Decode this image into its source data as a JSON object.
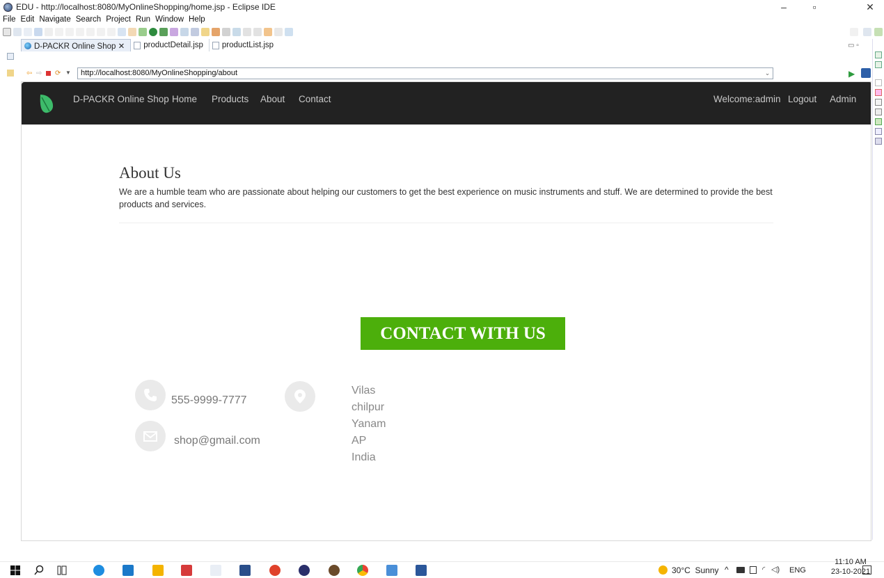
{
  "window": {
    "title": "EDU - http://localhost:8080/MyOnlineShopping/home.jsp - Eclipse IDE",
    "minimize": "–",
    "maximize": "▫",
    "close": "✕"
  },
  "menu": [
    "File",
    "Edit",
    "Navigate",
    "Search",
    "Project",
    "Run",
    "Window",
    "Help"
  ],
  "editor_tabs": [
    {
      "label": "D-PACKR Online Shop ✕",
      "active": true
    },
    {
      "label": "productDetail.jsp",
      "active": false
    },
    {
      "label": "productList.jsp",
      "active": false
    }
  ],
  "address": {
    "url": "http://localhost:8080/MyOnlineShopping/about"
  },
  "site": {
    "brand": "D-PACKR Online Shop",
    "nav": [
      "Home",
      "Products",
      "About",
      "Contact"
    ],
    "welcome": "Welcome:admin",
    "logout": "Logout",
    "admin": "Admin",
    "about_title": "About Us",
    "about_text": "We are a humble team who are passionate about helping our customers to get the best experience on music instruments and stuff. We are determined to provide the best products and services.",
    "contact_button": "CONTACT WITH US",
    "phone": "555-9999-7777",
    "email": "shop@gmail.com",
    "address_lines": [
      "Vilas",
      "chilpur",
      "Yanam",
      "AP",
      "India"
    ]
  },
  "taskbar": {
    "weather": "30°C  Sunny",
    "lang": "ENG",
    "time": "11:10 AM",
    "date": "23-10-2021"
  },
  "colors": {
    "navbar": "#222222",
    "contact_button": "#4caf0b",
    "leaf": "#3dbb6a"
  }
}
